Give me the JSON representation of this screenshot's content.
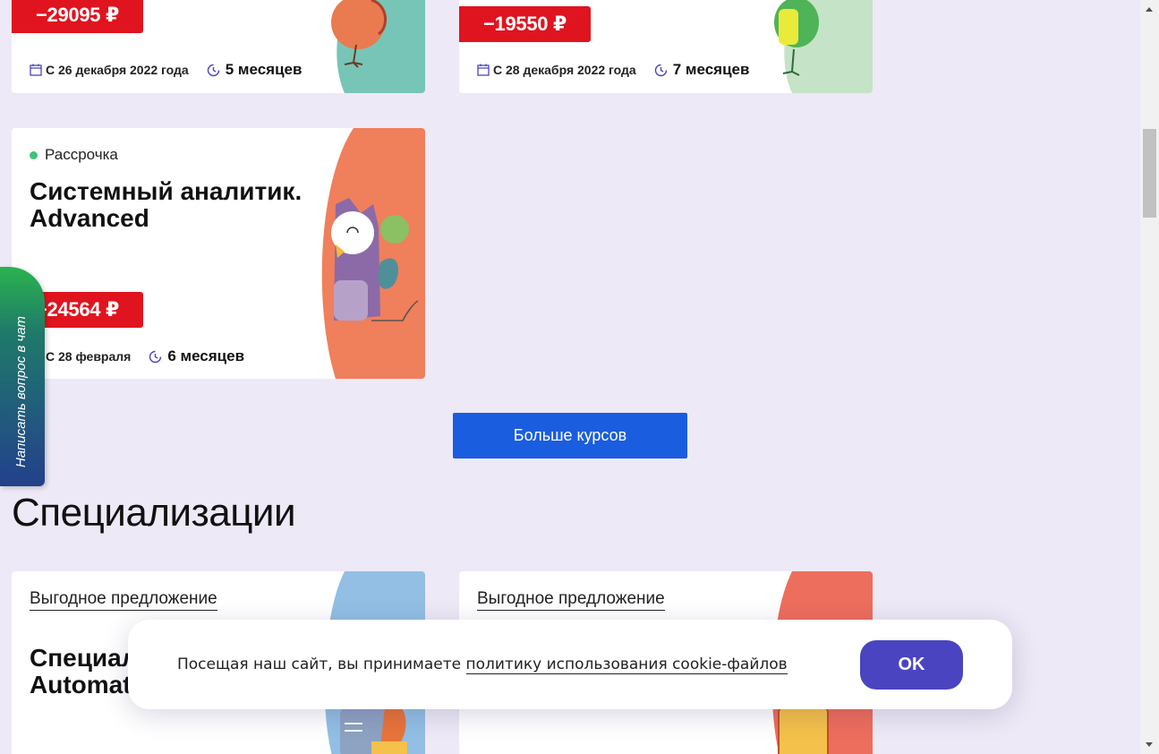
{
  "colors": {
    "background": "#ede9f6",
    "price_badge": "#e0141e",
    "primary_button": "#1a5ddf",
    "ok_button": "#4a44c0",
    "installment_dot": "#3cc37a"
  },
  "courses": [
    {
      "price": "−29095 ₽",
      "start": "С 26 декабря 2022 года",
      "duration": "5 месяцев",
      "calendar_icon": "calendar-icon",
      "clock_icon": "clock-icon"
    },
    {
      "price": "−19550 ₽",
      "start": "С 28 декабря 2022 года",
      "duration": "7 месяцев",
      "calendar_icon": "calendar-icon",
      "clock_icon": "clock-icon"
    },
    {
      "tag": "Рассрочка",
      "title": "Системный аналитик. Advanced",
      "price": "−24564 ₽",
      "start": "С 28 февраля",
      "duration": "6 месяцев"
    }
  ],
  "more_courses_button": "Больше курсов",
  "specializations": {
    "heading": "Специализации",
    "cards": [
      {
        "offer": "Выгодное предложение",
        "title": "Специал\nAutomat"
      },
      {
        "offer": "Выгодное предложение"
      }
    ]
  },
  "chat_tab": "Написать вопрос в чат",
  "cookie_banner": {
    "text": "Посещая наш сайт, вы принимаете ",
    "link": "политику использования cookie-файлов",
    "ok": "OK"
  }
}
